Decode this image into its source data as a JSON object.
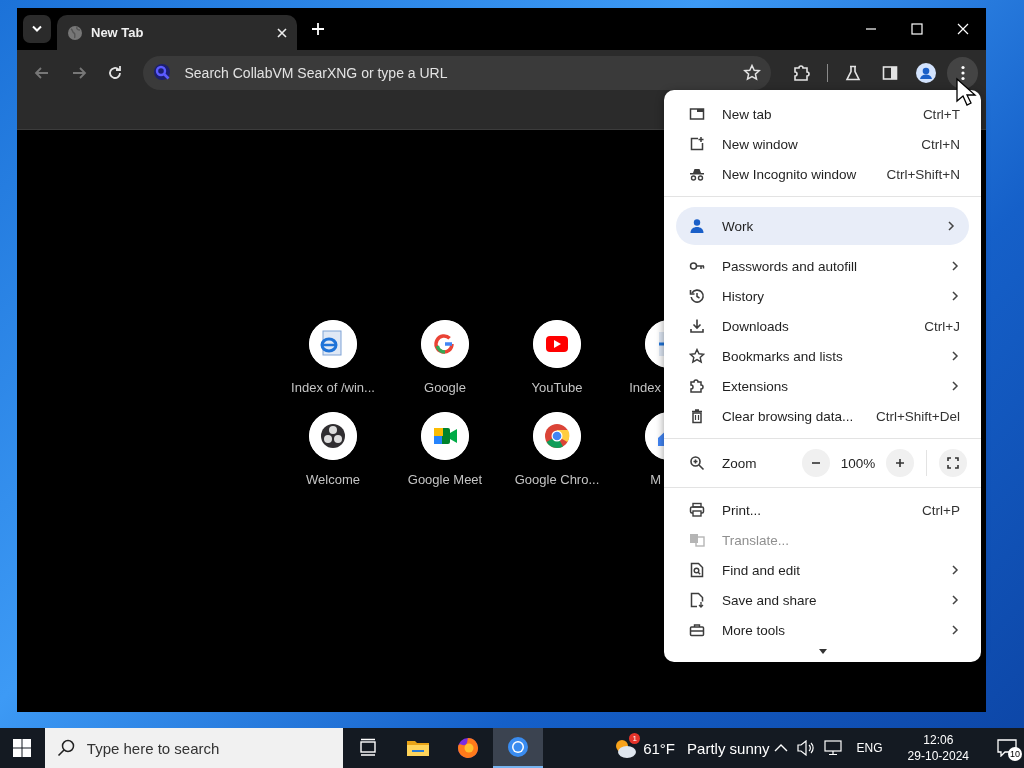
{
  "browser": {
    "tabs": [
      {
        "title": "New Tab",
        "selected": true
      }
    ],
    "toolbar": {
      "back": {
        "disabled": true
      },
      "forward": {
        "disabled": true
      },
      "omnibox": {
        "placeholder": "Search CollabVM SearXNG or type a URL"
      }
    },
    "shortcuts": [
      {
        "label": "Index of /win..."
      },
      {
        "label": "Google"
      },
      {
        "label": "YouTube"
      },
      {
        "label": "Index"
      },
      {
        "label": "Welcome"
      },
      {
        "label": "Google Meet"
      },
      {
        "label": "Google Chro..."
      },
      {
        "label": "M"
      }
    ]
  },
  "menu": {
    "groups": [
      [
        {
          "kind": "item",
          "label": "New tab",
          "shortcut": "Ctrl+T",
          "submenu": false,
          "disabled": false
        },
        {
          "kind": "item",
          "label": "New window",
          "shortcut": "Ctrl+N",
          "submenu": false,
          "disabled": false
        },
        {
          "kind": "item",
          "label": "New Incognito window",
          "shortcut": "Ctrl+Shift+N",
          "submenu": false,
          "disabled": false
        }
      ],
      [
        {
          "kind": "profile",
          "label": "Work",
          "submenu": true
        },
        {
          "kind": "item",
          "label": "Passwords and autofill",
          "submenu": true,
          "disabled": false
        },
        {
          "kind": "item",
          "label": "History",
          "submenu": true,
          "disabled": false
        },
        {
          "kind": "item",
          "label": "Downloads",
          "shortcut": "Ctrl+J",
          "submenu": false,
          "disabled": false
        },
        {
          "kind": "item",
          "label": "Bookmarks and lists",
          "submenu": true,
          "disabled": false
        },
        {
          "kind": "item",
          "label": "Extensions",
          "submenu": true,
          "disabled": false
        },
        {
          "kind": "item",
          "label": "Clear browsing data...",
          "shortcut": "Ctrl+Shift+Del",
          "submenu": false,
          "disabled": false
        }
      ],
      [
        {
          "kind": "zoom",
          "label": "Zoom",
          "value": "100%"
        }
      ],
      [
        {
          "kind": "item",
          "label": "Print...",
          "shortcut": "Ctrl+P",
          "submenu": false,
          "disabled": false
        },
        {
          "kind": "item",
          "label": "Translate...",
          "submenu": false,
          "disabled": true
        },
        {
          "kind": "item",
          "label": "Find and edit",
          "submenu": true,
          "disabled": false
        },
        {
          "kind": "item",
          "label": "Save and share",
          "submenu": true,
          "disabled": false
        },
        {
          "kind": "item",
          "label": "More tools",
          "submenu": true,
          "disabled": false
        }
      ]
    ]
  },
  "taskbar": {
    "search": {
      "placeholder": "Type here to search"
    },
    "apps": [
      {
        "selected": false
      },
      {
        "selected": false
      },
      {
        "selected": false
      },
      {
        "selected": true
      }
    ],
    "weather": {
      "badge": "1",
      "temperature": "61°F",
      "condition": "Partly sunny"
    },
    "language": "ENG",
    "time": "12:06",
    "date": "29-10-2024",
    "notifications": "10"
  }
}
